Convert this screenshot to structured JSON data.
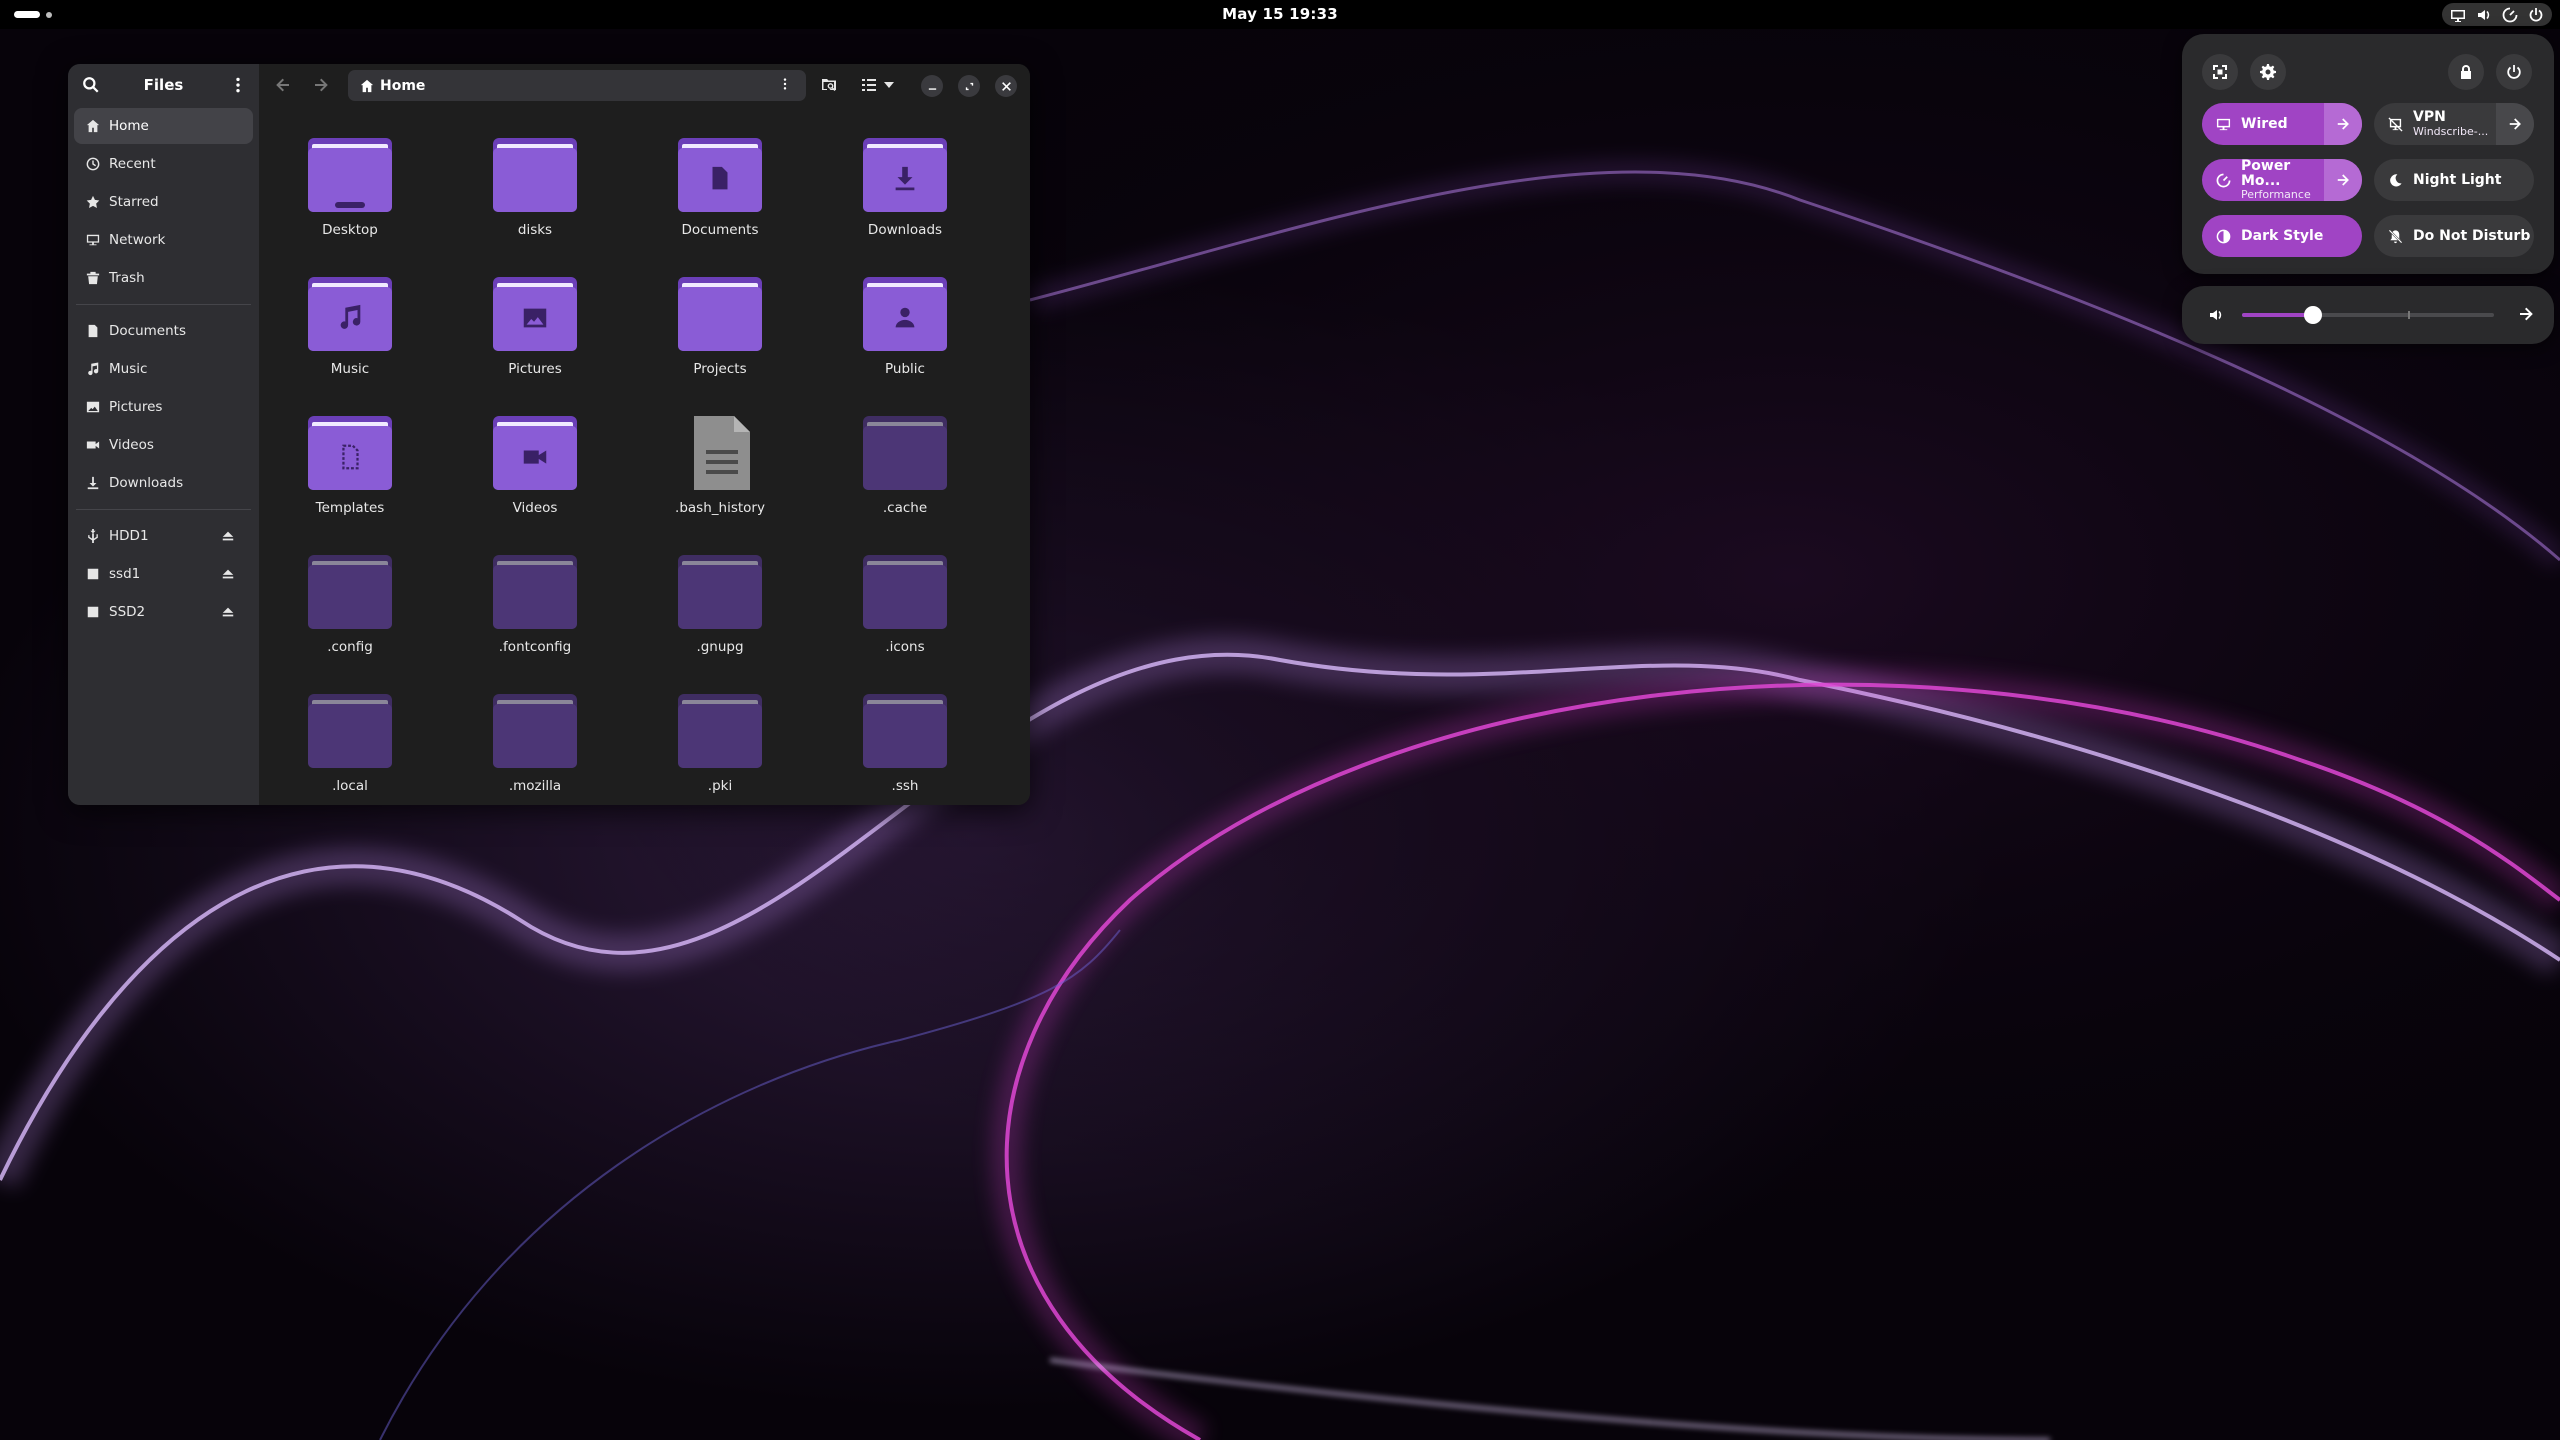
{
  "topbar": {
    "clock": "May 15  19:33"
  },
  "files": {
    "sidebar_title": "Files",
    "path": "Home",
    "places": [
      {
        "label": "Home",
        "icon": "home-icon",
        "active": true
      },
      {
        "label": "Recent",
        "icon": "clock-icon"
      },
      {
        "label": "Starred",
        "icon": "star-icon"
      },
      {
        "label": "Network",
        "icon": "network-icon"
      },
      {
        "label": "Trash",
        "icon": "trash-icon"
      }
    ],
    "bookmarks": [
      {
        "label": "Documents",
        "icon": "document-icon"
      },
      {
        "label": "Music",
        "icon": "music-icon"
      },
      {
        "label": "Pictures",
        "icon": "picture-icon"
      },
      {
        "label": "Videos",
        "icon": "video-icon"
      },
      {
        "label": "Downloads",
        "icon": "download-icon"
      }
    ],
    "devices": [
      {
        "label": "HDD1",
        "icon": "usb-icon"
      },
      {
        "label": "ssd1",
        "icon": "drive-icon"
      },
      {
        "label": "SSD2",
        "icon": "drive-icon"
      }
    ],
    "items": [
      {
        "label": "Desktop",
        "kind": "visible",
        "symbol": "desktop"
      },
      {
        "label": "disks",
        "kind": "visible",
        "symbol": "none"
      },
      {
        "label": "Documents",
        "kind": "visible",
        "symbol": "document"
      },
      {
        "label": "Downloads",
        "kind": "visible",
        "symbol": "download"
      },
      {
        "label": "Music",
        "kind": "visible",
        "symbol": "music"
      },
      {
        "label": "Pictures",
        "kind": "visible",
        "symbol": "picture"
      },
      {
        "label": "Projects",
        "kind": "visible",
        "symbol": "none"
      },
      {
        "label": "Public",
        "kind": "visible",
        "symbol": "person"
      },
      {
        "label": "Templates",
        "kind": "visible",
        "symbol": "template"
      },
      {
        "label": "Videos",
        "kind": "visible",
        "symbol": "video"
      },
      {
        "label": ".bash_history",
        "kind": "file",
        "symbol": "text"
      },
      {
        "label": ".cache",
        "kind": "hidden",
        "symbol": "none"
      },
      {
        "label": ".config",
        "kind": "hidden",
        "symbol": "none"
      },
      {
        "label": ".fontconfig",
        "kind": "hidden",
        "symbol": "none"
      },
      {
        "label": ".gnupg",
        "kind": "hidden",
        "symbol": "none"
      },
      {
        "label": ".icons",
        "kind": "hidden",
        "symbol": "none"
      },
      {
        "label": ".local",
        "kind": "hidden",
        "symbol": "none"
      },
      {
        "label": ".mozilla",
        "kind": "hidden",
        "symbol": "none"
      },
      {
        "label": ".pki",
        "kind": "hidden",
        "symbol": "none"
      },
      {
        "label": ".ssh",
        "kind": "hidden",
        "symbol": "none"
      }
    ]
  },
  "quick_settings": {
    "toggles": {
      "wired": {
        "label": "Wired",
        "on": true
      },
      "vpn": {
        "label": "VPN",
        "subtitle": "Windscribe-...",
        "on": false
      },
      "power": {
        "label": "Power Mo...",
        "subtitle": "Performance",
        "on": true
      },
      "night_light": {
        "label": "Night Light",
        "on": false
      },
      "dark_style": {
        "label": "Dark Style",
        "on": true
      },
      "dnd": {
        "label": "Do Not Disturb",
        "on": false
      }
    },
    "volume_fraction": 0.28
  },
  "colors": {
    "accent": "#a044c4",
    "folder": "#8a5cd6",
    "hidden_folder": "#4c3676"
  }
}
